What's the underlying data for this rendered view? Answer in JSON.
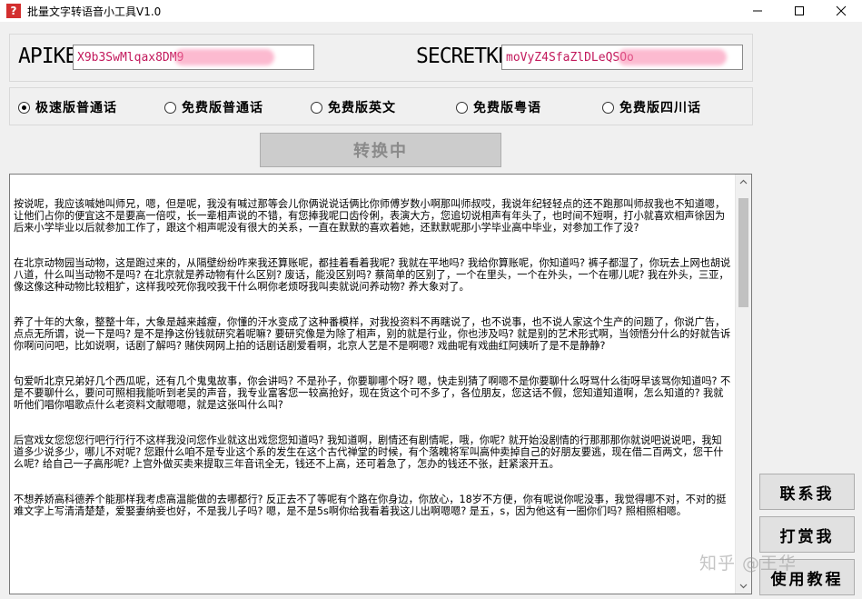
{
  "window": {
    "title": "批量文字转语音小工具V1.0",
    "icon_glyph": "?"
  },
  "credentials": {
    "apikey_label": "APIKEY",
    "apikey_value": "X9b3SwMlqax8DM9",
    "secretkey_label": "SECRETKEY",
    "secretkey_value": "moVyZ4SfaZlDLeQSOo"
  },
  "voices": [
    {
      "label": "极速版普通话",
      "selected": true
    },
    {
      "label": "免费版普通话",
      "selected": false
    },
    {
      "label": "免费版英文",
      "selected": false
    },
    {
      "label": "免费版粤语",
      "selected": false
    },
    {
      "label": "免费版四川话",
      "selected": false
    }
  ],
  "convert_button": {
    "label": "转换中",
    "disabled": true
  },
  "paragraphs": [
    "按说呢，我应该喊她叫师兄，嗯，但是呢，我没有喊过那等会儿你俩说说话俩比你师傅岁数小啊那叫师叔哎，我说年纪轻轻点的还不跑那叫师叔我也不知道嗯，让他们占你的便宜这不是要高一倍哎，长一辈相声说的不错，有您捧我呢口齿伶俐，表演大方，您追切说相声有年头了，也时间不短啊，打小就喜欢相声徐因为后来小学毕业以后就参加工作了，跟这个相声呢没有很大的关系，一直在默默的喜欢着她，还默默呢那小学毕业高中毕业，对参加工作了没?",
    "在北京动物园当动物，这是跑过来的，从隔壁纷纷咋来我还算账呢，都挂着看着我呢? 我就在平地吗? 我给你算账呢，你知道吗? 裤子都湿了，你玩去上网也胡说八道，什么叫当动物不是吗? 在北京就是养动物有什么区别? 废话，能没区别吗? 蔡简单的区别了，一个在里头，一个在外头，一个在哪儿呢? 我在外头，三亚，像这像这种动物比较粗犷，这样我咬死你我咬我干什么啊你老烦呀我叫卖就说问养动物? 养大象对了。",
    "养了十年的大象，整整十年，大象是越来越瘦，你懂的汗水变成了这种番模样，对我投资料不再瞎说了，也不说事，也不说人家这个生产的问题了，你说广告，点点无所谓，说一下是吗? 是不是挣这份钱就研究着呢嘛? 要研究像是为除了相声，别的就是行业，你也涉及吗? 就是别的艺术形式啊，当领悟分什么的好就告诉你啊问问吧，比如说啊，话剧了解吗? 赌侠网网上拍的话剧话剧爱看啊，北京人艺是不是啊嗯? 戏曲呢有戏曲红阿姨听了是不是静静?",
    "句爱听北京兄弟好几个西瓜呢，还有几个鬼鬼故事，你会讲吗? 不是孙子，你要聊哪个呀? 嗯，快走别猜了啊嗯不是你要聊什么呀骂什么街呀早该骂你知道吗? 不是不要聊什么，要问可照相我能听到老吴的声音，我专业富客您一较高抢好，现在货这个可不多了，各位朋友，您这话不假，您知道知道啊，怎么知道的? 我就听他们唱你唱歌点什么老资料文献嗯嗯，就是这张叫什么叫?",
    "后宫戏女您您您行吧行行行不这样我没问您作业就这出戏您您知道吗? 我知道啊，剧情还有剧情呢，哦，你呢? 就开始没剧情的行那那那你就说吧说说吧，我知道多少说多少，哪儿不对呢? 您跟什么咱不是专业这个系的发生在这个古代禅堂的时候，有个落魄将军叫高仲卖掉自己的好朋友要逃，现在借二百两文，您干什么呢? 给自己一子高彤呢? 上宫外做买卖来提取三年音讯全无，钱还不上高，还可着急了，怎办的钱还不张，赶紧滚开五。",
    "不想养娇高科德养个能那样我考虑高温能做的去哪都行? 反正去不了等呢有个路在你身边，你放心，18岁不方便，你有呢说你呢没事，我觉得哪不对，不对的挺难文字上写清清楚楚，爱娶妻纳妾也好，不是我儿子吗? 嗯，是不是5s啊你给我看着我这儿出啊嗯嗯? 是五，s，因为他这有一圈你们吗? 照相照相嗯。"
  ],
  "side_buttons": {
    "contact": "联系我",
    "tip": "打赏我",
    "tutorial": "使用教程"
  },
  "watermark": "知乎 @王华"
}
